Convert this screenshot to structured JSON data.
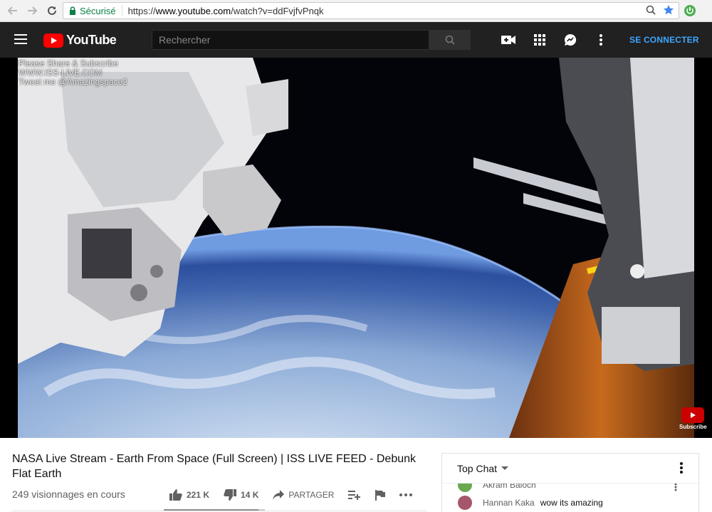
{
  "browser": {
    "secure_label": "Sécurisé",
    "url_prefix": "https://",
    "url_domain": "www.youtube.com",
    "url_path": "/watch?v=ddFvjfvPnqk"
  },
  "youtube": {
    "logo_text": "YouTube",
    "search_placeholder": "Rechercher",
    "signin_label": "SE CONNECTER"
  },
  "player": {
    "watermark": [
      "Please Share & Subscribe",
      "WWW.ISS-LIVE.COM",
      "Tweet me @Amazingspace2"
    ],
    "subscribe_watermark": "Subscribe"
  },
  "video": {
    "title": "NASA Live Stream - Earth From Space (Full Screen) | ISS LIVE FEED - Debunk Flat Earth",
    "views": "249 visionnages en cours",
    "likes": "221 K",
    "dislikes": "14 K",
    "share_label": "PARTAGER",
    "like_ratio": 0.94
  },
  "chat": {
    "header": "Top Chat",
    "messages": [
      {
        "author": "Akram Baloch",
        "text": ""
      },
      {
        "author": "Hannan Kaka",
        "text": "wow its amazing"
      }
    ]
  },
  "colors": {
    "yt_red": "#ff0000",
    "masthead": "#212121",
    "link_blue": "#3ea6ff",
    "secure_green": "#0b8043"
  }
}
